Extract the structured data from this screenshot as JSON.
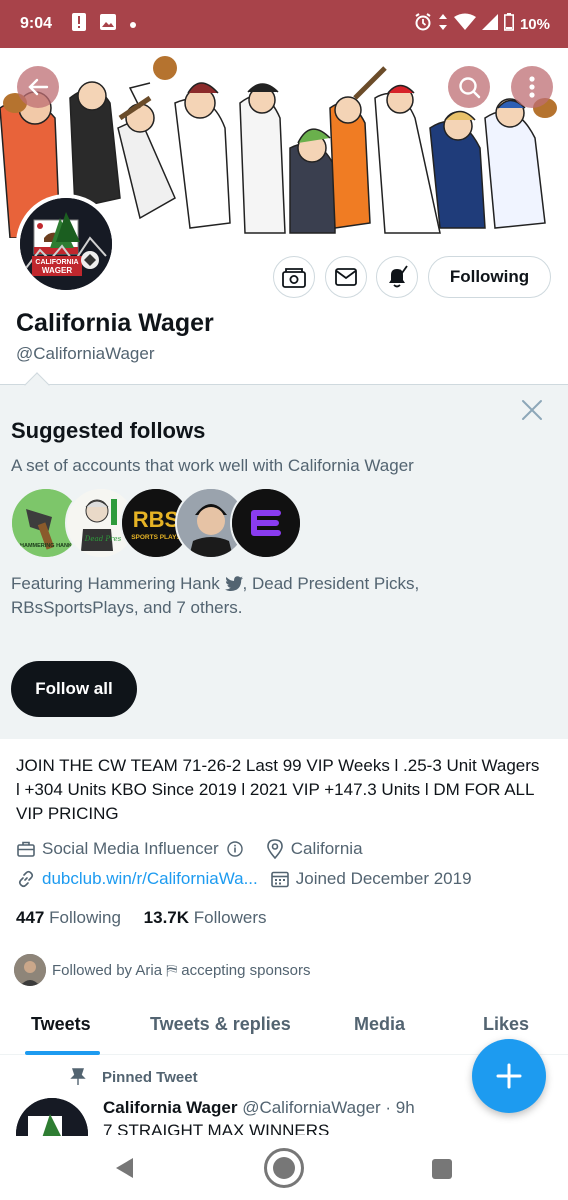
{
  "status_bar": {
    "time": "9:04",
    "battery": "10%",
    "left_icons": [
      "alert-icon",
      "image-icon",
      "dot-icon"
    ],
    "right_icons": [
      "alarm-icon",
      "data-arrows-icon",
      "wifi-icon",
      "signal-icon",
      "battery-icon"
    ]
  },
  "header": {
    "back_icon": "arrow-left-icon",
    "search_icon": "search-icon",
    "more_icon": "more-vertical-icon"
  },
  "avatar": {
    "lettering": "CALIFORNIA WAGER"
  },
  "actions": {
    "photo_icon": "camera-money-icon",
    "message_icon": "envelope-icon",
    "notify_icon": "bell-check-icon",
    "follow_label": "Following"
  },
  "profile": {
    "name": "California Wager",
    "handle": "@CaliforniaWager",
    "bio": "JOIN THE CW TEAM 71-26-2 Last 99 VIP Weeks l .25-3 Unit Wagers l +304 Units KBO Since 2019 l 2021 VIP +147.3 Units l DM FOR ALL VIP PRICING",
    "category": "Social Media Influencer",
    "location": "California",
    "website": "dubclub.win/r/CaliforniaWa...",
    "joined": "Joined December 2019",
    "following_count": "447",
    "following_label": "Following",
    "followers_count": "13.7K",
    "followers_label": "Followers",
    "followed_by": "Followed by Aria ⛿ accepting sponsors"
  },
  "suggested": {
    "title": "Suggested follows",
    "subtitle": "A set of accounts that work well with California Wager",
    "featuring_prefix": "Featuring Hammering Hank",
    "featuring_rest": ", Dead President Picks, RBsSportsPlays, and 7 others.",
    "follow_all_label": "Follow all",
    "avatar_labels": [
      "HAMMERING HANK",
      "Dead Pres Picks",
      "RBS SPORTS PLAYS"
    ]
  },
  "tabs": [
    {
      "label": "Tweets"
    },
    {
      "label": "Tweets & replies"
    },
    {
      "label": "Media"
    },
    {
      "label": "Likes"
    }
  ],
  "pinned": {
    "label": "Pinned Tweet",
    "author": "California Wager",
    "handle_time": "@CaliforniaWager · 9h",
    "text": "7 STRAIGHT MAX WINNERS"
  },
  "colors": {
    "status_bar": "#a8434a",
    "accent": "#1d9bf0",
    "suggest_bg": "#eff3f4",
    "text_secondary": "#536471"
  }
}
